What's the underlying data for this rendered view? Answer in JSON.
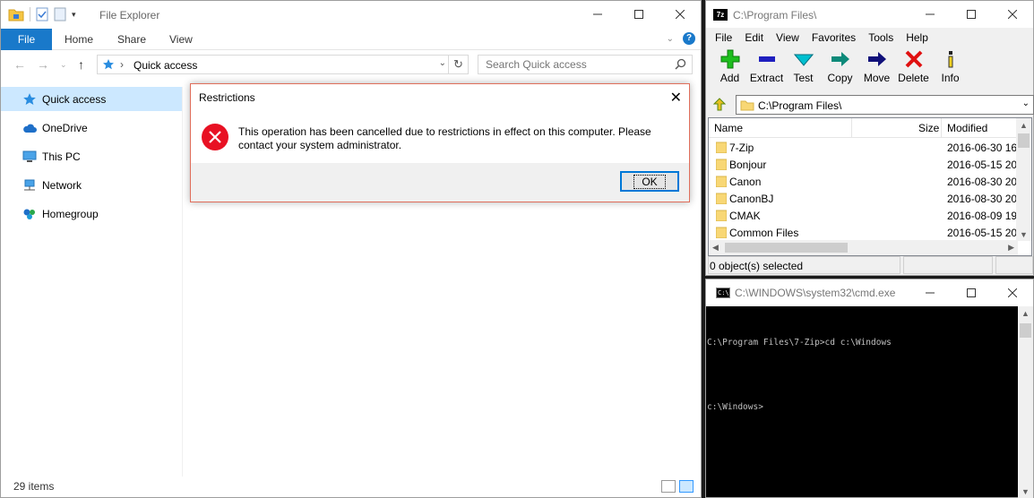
{
  "file_explorer": {
    "title": "File Explorer",
    "ribbon_tabs": [
      "File",
      "Home",
      "Share",
      "View"
    ],
    "address": "Quick access",
    "search_placeholder": "Search Quick access",
    "nav_items": [
      {
        "label": "Quick access",
        "icon": "star-icon",
        "selected": true
      },
      {
        "label": "OneDrive",
        "icon": "cloud-icon"
      },
      {
        "label": "This PC",
        "icon": "monitor-icon"
      },
      {
        "label": "Network",
        "icon": "network-icon"
      },
      {
        "label": "Homegroup",
        "icon": "homegroup-icon"
      }
    ],
    "status": "29 items",
    "accent_color": "#1979ca"
  },
  "dialog": {
    "title": "Restrictions",
    "message": "This operation has been cancelled due to restrictions in effect on this computer. Please contact your system administrator.",
    "ok_label": "OK",
    "icon": "error-icon",
    "icon_color": "#e81123"
  },
  "sevenzip": {
    "title": "C:\\Program Files\\",
    "menu": [
      "File",
      "Edit",
      "View",
      "Favorites",
      "Tools",
      "Help"
    ],
    "toolbar": [
      {
        "label": "Add",
        "icon": "plus-icon",
        "color": "#1ebe1e"
      },
      {
        "label": "Extract",
        "icon": "minus-icon",
        "color": "#1f1fbf"
      },
      {
        "label": "Test",
        "icon": "check-icon",
        "color": "#00a0b0"
      },
      {
        "label": "Copy",
        "icon": "copy-arrow-icon",
        "color": "#0d8a7a"
      },
      {
        "label": "Move",
        "icon": "move-arrow-icon",
        "color": "#10107a"
      },
      {
        "label": "Delete",
        "icon": "x-icon",
        "color": "#e01010"
      },
      {
        "label": "Info",
        "icon": "info-icon",
        "color": "#d4b000"
      }
    ],
    "path": "C:\\Program Files\\",
    "columns": {
      "name": "Name",
      "size": "Size",
      "modified": "Modified"
    },
    "rows": [
      {
        "name": "7-Zip",
        "modified": "2016-06-30 16:"
      },
      {
        "name": "Bonjour",
        "modified": "2016-05-15 20:"
      },
      {
        "name": "Canon",
        "modified": "2016-08-30 20:"
      },
      {
        "name": "CanonBJ",
        "modified": "2016-08-30 20:"
      },
      {
        "name": "CMAK",
        "modified": "2016-08-09 19:"
      },
      {
        "name": "Common Files",
        "modified": "2016-05-15 20:"
      }
    ],
    "status": "0 object(s) selected"
  },
  "cmd": {
    "title": "C:\\WINDOWS\\system32\\cmd.exe",
    "lines": [
      "C:\\Program Files\\7-Zip>cd c:\\Windows",
      "",
      "c:\\Windows>"
    ]
  }
}
